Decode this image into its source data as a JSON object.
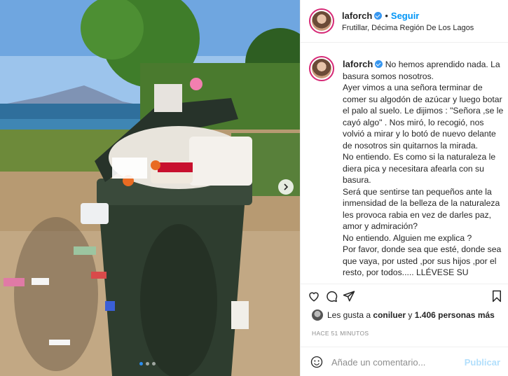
{
  "header": {
    "username": "laforch",
    "separator": "•",
    "follow_label": "Seguir",
    "location": "Frutillar, Décima Región De Los Lagos",
    "more_label": "..."
  },
  "caption": {
    "username": "laforch",
    "text": "No hemos aprendido nada. La basura somos nosotros.\nAyer vimos a una señora terminar de comer su algodón de azúcar y luego botar el palo al suelo. Le dijimos : \"Señora ,se le cayó algo\" . Nos miró, lo recogió, nos volvió a mirar y lo botó de nuevo delante de nosotros sin quitarnos la mirada.\nNo entiendo. Es como si la naturaleza le diera pica y necesitara afearla con su basura.\nSerá que sentirse tan pequeños ante la inmensidad de la belleza de la naturaleza les provoca rabia en vez de darles paz, amor y admiración?\nNo entiendo. Alguien me explica ?\nPor favor, donde sea que esté, donde sea que vaya, por usted ,por sus hijos ,por el resto, por todos..... LLÉVESE SU"
  },
  "icons": {
    "like": "heart-icon",
    "comment": "comment-icon",
    "share": "share-icon",
    "save": "bookmark-icon",
    "emoji": "smiley-icon",
    "next": "chevron-right-icon",
    "verified": "verified-badge-icon"
  },
  "likes": {
    "prefix": "Les gusta a ",
    "user": "coniluer",
    "middle": " y ",
    "count": "1.406 personas más"
  },
  "timestamp": "HACE 51 MINUTOS",
  "comment": {
    "placeholder": "Añade un comentario...",
    "publish_label": "Publicar"
  },
  "carousel": {
    "slides": 3,
    "active_index": 0
  },
  "colors": {
    "accent": "#0095f6",
    "publish_disabled": "#b2dffc",
    "verified": "#3897f0"
  }
}
